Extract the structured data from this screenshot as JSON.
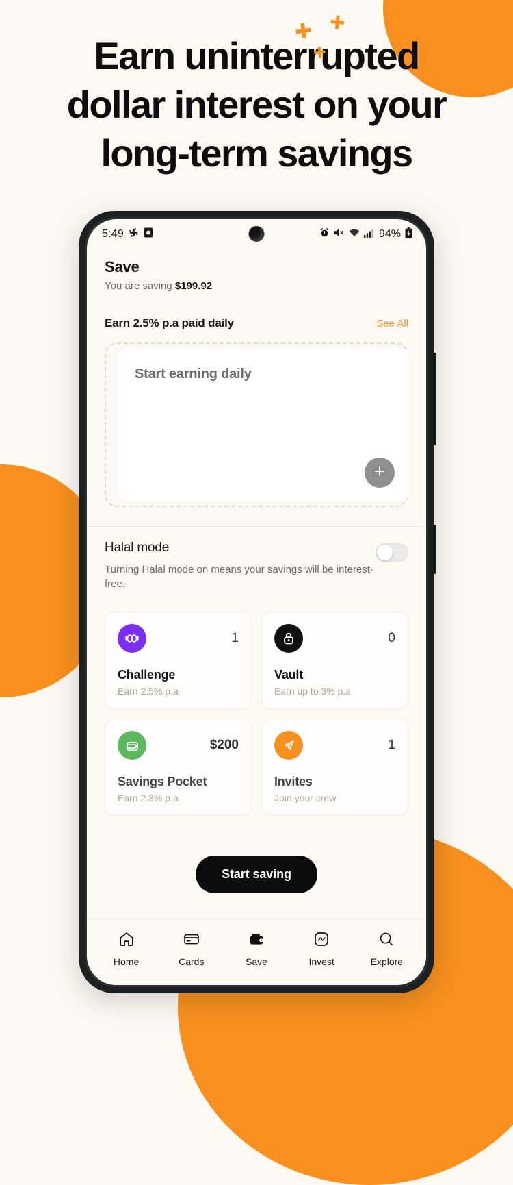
{
  "promo": {
    "headline_line1": "Earn uninterrupted",
    "headline_line2": "dollar interest on your",
    "headline_line3": "long-term savings",
    "accent_color": "#f7901e",
    "background_color": "#fdf8f2",
    "sparkle_icons": [
      "sparkle-plus-icon",
      "sparkle-plus-icon",
      "sparkle-plus-icon"
    ]
  },
  "phone": {
    "statusbar": {
      "time": "5:49",
      "battery_percent": "94%",
      "left_icons": [
        "slack-icon",
        "screenshot-icon"
      ],
      "right_icons": [
        "alarm-icon",
        "mute-icon",
        "wifi-icon",
        "signal-icon",
        "battery-charging-icon"
      ]
    },
    "header": {
      "title": "Save",
      "subtitle_prefix": "You are saving ",
      "amount": "$199.92"
    },
    "earn_section": {
      "title": "Earn 2.5% p.a paid daily",
      "see_all": "See All",
      "card_title": "Start earning daily",
      "add_icon": "plus-icon"
    },
    "halal": {
      "title": "Halal mode",
      "description": "Turning Halal mode on means your savings will be interest-free.",
      "toggle_state": "off"
    },
    "feature_cards": [
      {
        "name": "Challenge",
        "subtitle": "Earn 2.5% p.a",
        "count": "1",
        "icon": "challenge-coins-icon",
        "icon_bg": "#7b2ff2"
      },
      {
        "name": "Vault",
        "subtitle": "Earn up to 3% p.a",
        "count": "0",
        "icon": "lock-icon",
        "icon_bg": "#111111"
      },
      {
        "name": "Savings Pocket",
        "subtitle": "Earn 2.3% p.a",
        "count": "$200",
        "icon": "wallet-icon",
        "icon_bg": "#5cb85c"
      },
      {
        "name": "Invites",
        "subtitle": "Join your crew",
        "count": "1",
        "icon": "send-plane-icon",
        "icon_bg": "#f7901e"
      }
    ],
    "cta": {
      "label": "Start saving"
    },
    "bottom_nav": [
      {
        "label": "Home",
        "icon": "home-icon",
        "active": false
      },
      {
        "label": "Cards",
        "icon": "card-icon",
        "active": false
      },
      {
        "label": "Save",
        "icon": "wallet-filled-icon",
        "active": true
      },
      {
        "label": "Invest",
        "icon": "chart-squircle-icon",
        "active": false
      },
      {
        "label": "Explore",
        "icon": "search-icon",
        "active": false
      }
    ]
  }
}
